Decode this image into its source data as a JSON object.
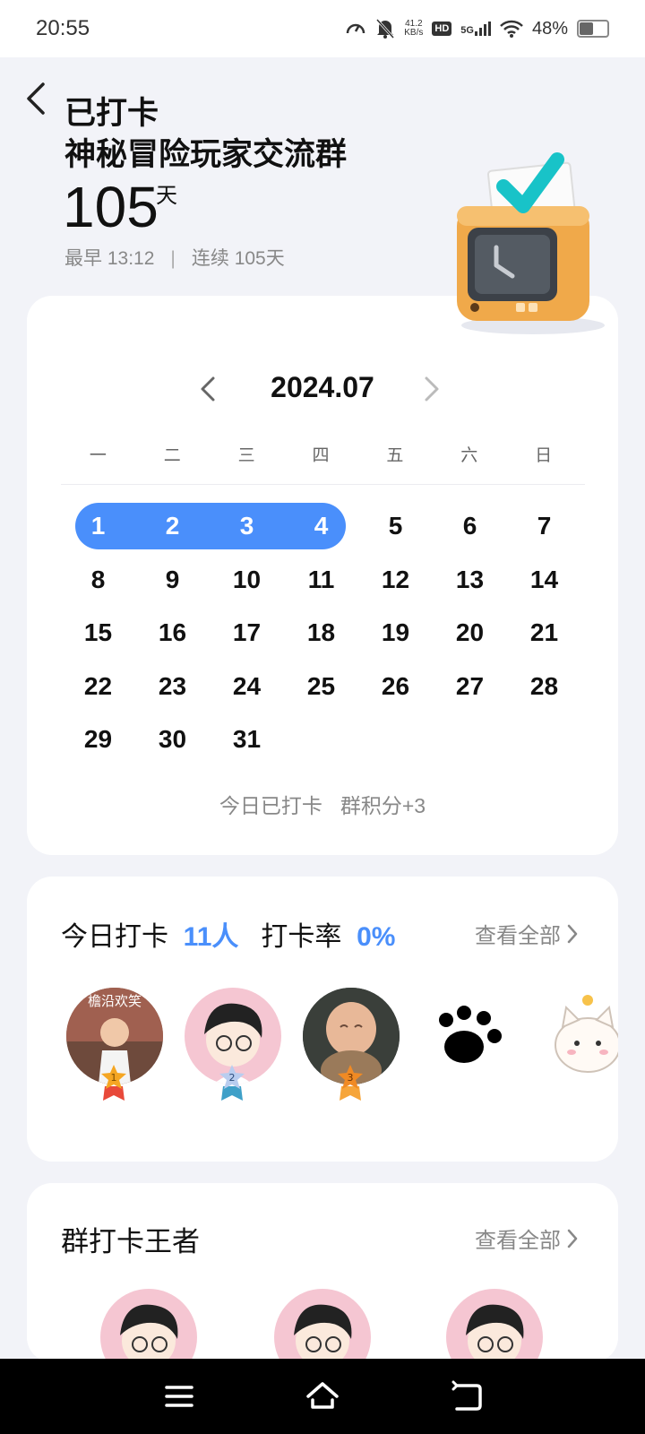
{
  "status_bar": {
    "time": "20:55",
    "net_speed": "41.2",
    "net_unit": "KB/s",
    "hd": "HD",
    "network": "5G",
    "battery": "48%"
  },
  "header": {
    "title_line1": "已打卡",
    "title_line2": "神秘冒险玩家交流群",
    "days": "105",
    "days_unit": "天",
    "earliest": "最早 13:12",
    "separator": "|",
    "streak": "连续 105天"
  },
  "calendar": {
    "month": "2024.07",
    "weekdays": [
      "一",
      "二",
      "三",
      "四",
      "五",
      "六",
      "日"
    ],
    "checked_days": [
      1,
      2,
      3,
      4
    ],
    "footer_checked": "今日已打卡",
    "footer_points": "群积分+3"
  },
  "today": {
    "label_checkin": "今日打卡",
    "count": "11人",
    "label_rate": "打卡率",
    "rate": "0%",
    "view_all": "查看全部",
    "avatar_text": "檐沿欢笑",
    "ranks": [
      "1",
      "2",
      "3"
    ]
  },
  "king": {
    "title": "群打卡王者",
    "view_all": "查看全部"
  },
  "colors": {
    "accent": "#4a8ffb",
    "gold": "#f5a623",
    "silver": "#7fb3e8",
    "bronze": "#f08a24"
  }
}
